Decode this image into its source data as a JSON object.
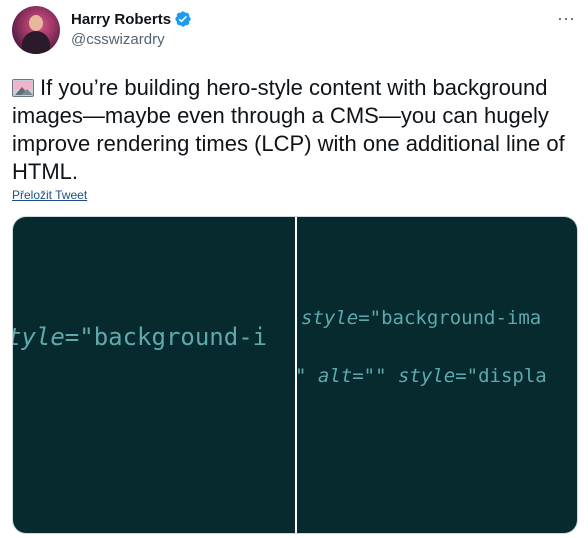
{
  "author": {
    "display_name": "Harry Roberts",
    "handle": "@csswizardry",
    "verified_badge_icon": "verified-badge-icon",
    "badge_color": "#1d9bf0"
  },
  "more_menu": {
    "icon": "more-horizontal-icon",
    "label": "···"
  },
  "tweet": {
    "emoji_icon": "framed-picture-emoji",
    "text": "If you’re building hero-style content with background images—maybe even through a CMS—you can hugely improve rendering times (LCP) with one additional line of HTML.",
    "translate_label": "Přeložit Tweet"
  },
  "media": {
    "left_image": {
      "code_attr": "tyle",
      "code_rest": "=\"background-i"
    },
    "right_image": {
      "line1_attr": "style",
      "line1_rest": "=\"background-ima",
      "line2_prefix": "\" ",
      "line2_attr1": "alt",
      "line2_mid": "=\"\" ",
      "line2_attr2": "style",
      "line2_rest": "=\"displa"
    },
    "background_color": "#062a2e",
    "code_color": "#5fa9ad"
  }
}
